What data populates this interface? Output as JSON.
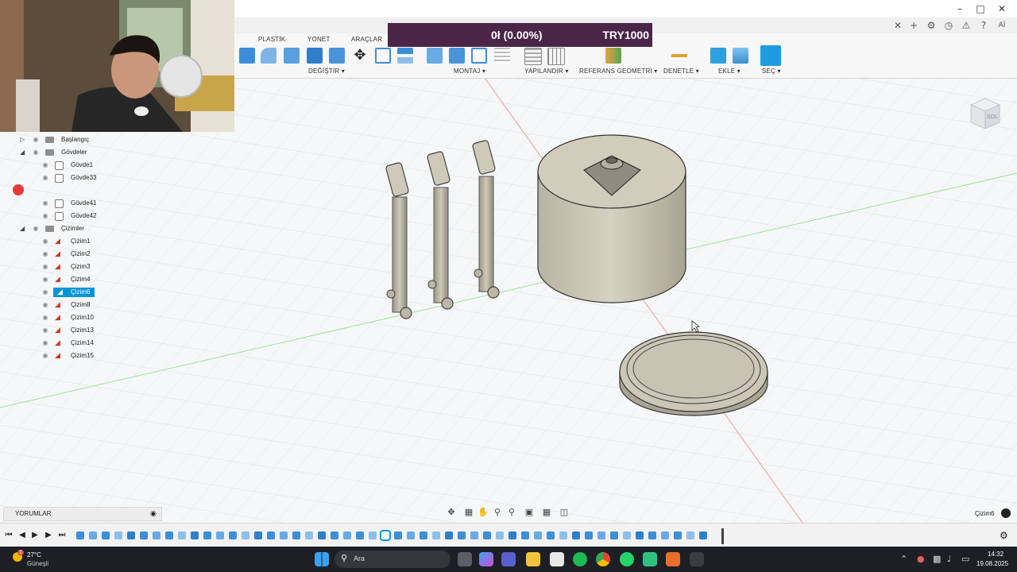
{
  "promo": {
    "usage": "0ł (0.00%)",
    "amount": "TRY1000"
  },
  "toolbar": {
    "tabs": [
      "PLASTİK",
      "YÖNET",
      "ARAÇLAR"
    ],
    "groups": [
      "DEĞİŞTİR ▾",
      "MONTAJ ▾",
      "YAPILANDIR ▾",
      "REFERANS GEOMETRİ ▾",
      "DENETLE ▾",
      "EKLE ▾",
      "SEÇ ▾"
    ]
  },
  "user_badge": "Aİ",
  "browser": {
    "items": [
      {
        "label": "Başlangıç",
        "type": "folder"
      },
      {
        "label": "Gövdeler",
        "type": "folder"
      },
      {
        "label": "Gövde1",
        "type": "body"
      },
      {
        "label": "Gövde33",
        "type": "body"
      },
      {
        "label": "Gövde41",
        "type": "body"
      },
      {
        "label": "Gövde42",
        "type": "body"
      },
      {
        "label": "Çizimler",
        "type": "folder"
      },
      {
        "label": "Çizim1",
        "type": "sketch"
      },
      {
        "label": "Çizim2",
        "type": "sketch"
      },
      {
        "label": "Çizim3",
        "type": "sketch"
      },
      {
        "label": "Çizim4",
        "type": "sketch"
      },
      {
        "label": "Çizim6",
        "type": "sketch",
        "selected": true
      },
      {
        "label": "Çizim8",
        "type": "sketch"
      },
      {
        "label": "Çizim10",
        "type": "sketch"
      },
      {
        "label": "Çizim13",
        "type": "sketch"
      },
      {
        "label": "Çizim14",
        "type": "sketch"
      },
      {
        "label": "Çizim15",
        "type": "sketch"
      }
    ]
  },
  "viewcube_label": "SOL",
  "comments_label": "YORUMLAR",
  "status_selection": "Çizim6",
  "taskbar": {
    "weather_temp": "27°C",
    "weather_desc": "Güneşli",
    "search_placeholder": "Ara",
    "time": "14:32",
    "date": "19.08.2025",
    "notification_badge": "1"
  },
  "colors": {
    "promo_bg": "#4a2547",
    "accent": "#0696d7",
    "taskbar_bg": "#1d1f24",
    "model_surface": "#c9c3b3"
  }
}
